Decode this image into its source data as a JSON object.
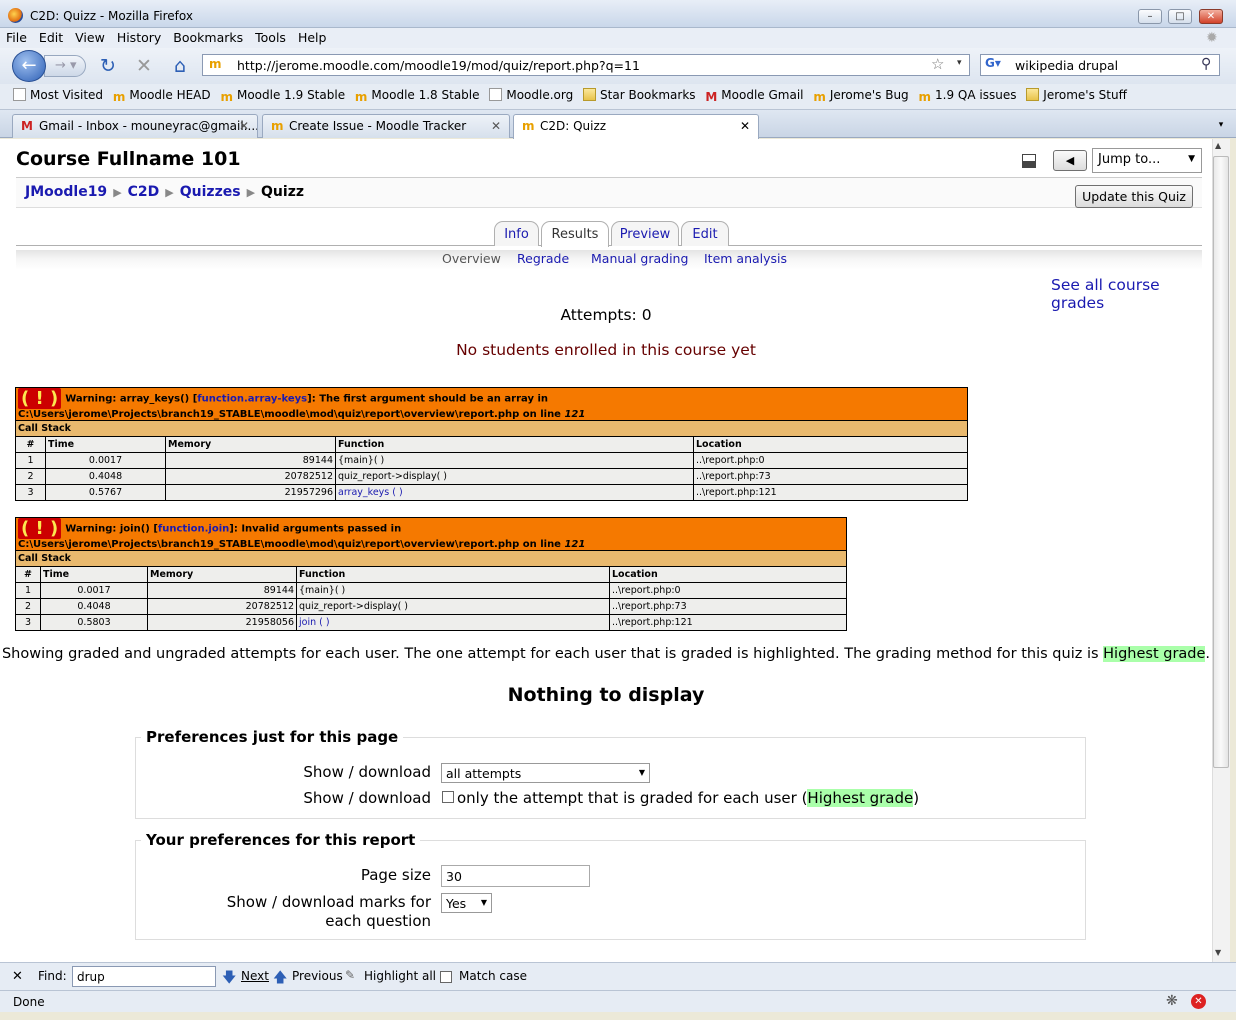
{
  "window": {
    "title": "C2D: Quizz - Mozilla Firefox"
  },
  "menu": [
    "File",
    "Edit",
    "View",
    "History",
    "Bookmarks",
    "Tools",
    "Help"
  ],
  "url": "http://jerome.moodle.com/moodle19/mod/quiz/report.php?q=11",
  "search": "wikipedia drupal",
  "bookmarks": [
    "Most Visited",
    "Moodle HEAD",
    "Moodle 1.9 Stable",
    "Moodle 1.8 Stable",
    "Moodle.org",
    "Star Bookmarks",
    "Moodle Gmail",
    "Jerome's Bug",
    "1.9 QA issues",
    "Jerome's Stuff"
  ],
  "tabs": [
    "Gmail - Inbox - mouneyrac@gmail....",
    "Create Issue - Moodle Tracker",
    "C2D: Quizz"
  ],
  "page": {
    "course_title": "Course Fullname 101",
    "jump_to": "Jump to...",
    "update_btn": "Update this Quiz",
    "breadcrumb": [
      "JMoodle19",
      "C2D",
      "Quizzes",
      "Quizz"
    ],
    "quiz_tabs": [
      "Info",
      "Results",
      "Preview",
      "Edit"
    ],
    "sub_tabs": [
      "Overview",
      "Regrade",
      "Manual grading",
      "Item analysis"
    ],
    "see_grades": "See all course grades",
    "attempts": "Attempts: 0",
    "no_students": "No students enrolled in this course yet",
    "showing_text": "Showing graded and ungraded attempts for each user. The one attempt for each user that is graded is highlighted. The grading method for this quiz is ",
    "grading_method": "Highest grade",
    "nothing": "Nothing to display",
    "pref_page_legend": "Preferences just for this page",
    "show_download": "Show / download",
    "attempts_select": "all attempts",
    "only_graded": "only the attempt that is graded for each user (",
    "pref_report_legend": "Your preferences for this report",
    "page_size_label": "Page size",
    "page_size": "30",
    "marks_label": "Show / download marks for each question",
    "marks_value": "Yes"
  },
  "errors": [
    {
      "warn_prefix": "Warning: array_keys() [",
      "func_link": "function.array-keys",
      "warn_msg": "]: The first argument should be an array in C:\\Users\\jerome\\Projects\\branch19_STABLE\\moodle\\mod\\quiz\\report\\overview\\report.php on line ",
      "line": "121",
      "call_stack": "Call Stack",
      "headers": [
        "#",
        "Time",
        "Memory",
        "Function",
        "Location"
      ],
      "rows": [
        [
          "1",
          "0.0017",
          "89144",
          "{main}( )",
          "..\\report.php:0"
        ],
        [
          "2",
          "0.4048",
          "20782512",
          "quiz_report->display( )",
          "..\\report.php:73"
        ],
        [
          "3",
          "0.5767",
          "21957296",
          "array_keys ( )",
          "..\\report.php:121"
        ]
      ]
    },
    {
      "warn_prefix": "Warning: join() [",
      "func_link": "function.join",
      "warn_msg": "]: Invalid arguments passed in C:\\Users\\jerome\\Projects\\branch19_STABLE\\moodle\\mod\\quiz\\report\\overview\\report.php on line ",
      "line": "121",
      "call_stack": "Call Stack",
      "headers": [
        "#",
        "Time",
        "Memory",
        "Function",
        "Location"
      ],
      "rows": [
        [
          "1",
          "0.0017",
          "89144",
          "{main}( )",
          "..\\report.php:0"
        ],
        [
          "2",
          "0.4048",
          "20782512",
          "quiz_report->display( )",
          "..\\report.php:73"
        ],
        [
          "3",
          "0.5803",
          "21958056",
          "join ( )",
          "..\\report.php:121"
        ]
      ]
    }
  ],
  "findbar": {
    "label": "Find:",
    "value": "drup",
    "next": "Next",
    "previous": "Previous",
    "highlight": "Highlight all",
    "match_case": "Match case"
  },
  "status": "Done"
}
